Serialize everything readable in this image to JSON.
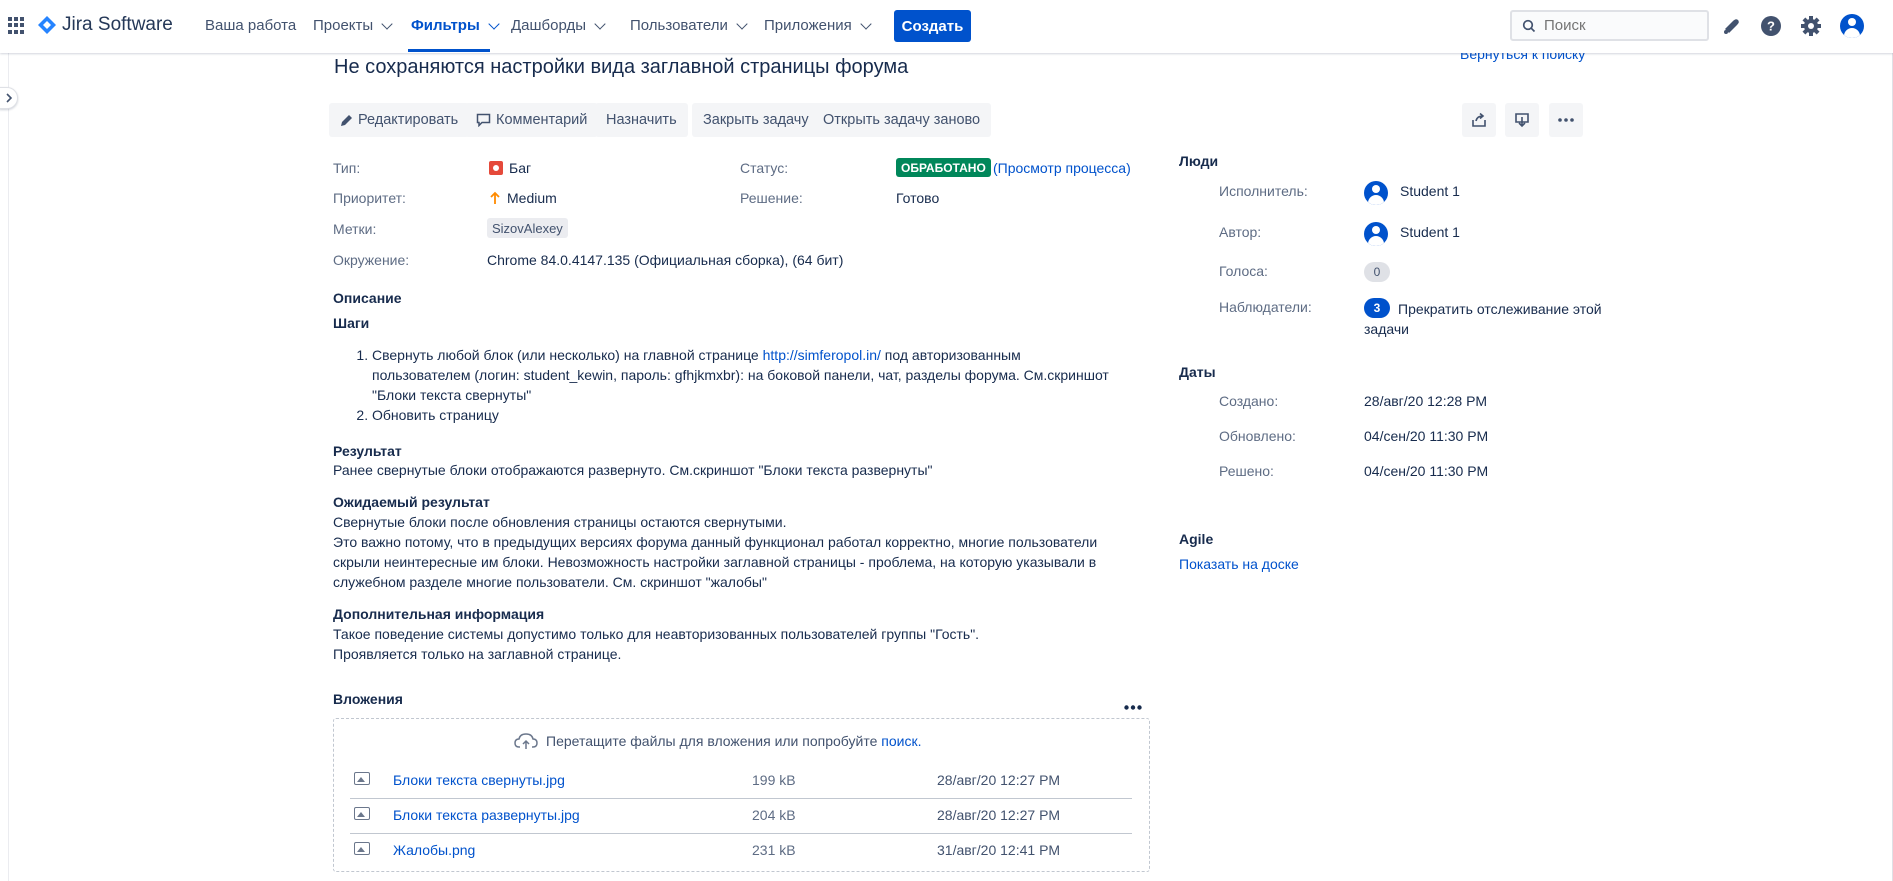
{
  "nav": {
    "product": "Jira Software",
    "items": [
      {
        "label": "Ваша работа",
        "dropdown": false
      },
      {
        "label": "Проекты",
        "dropdown": true
      },
      {
        "label": "Фильтры",
        "dropdown": true,
        "active": true
      },
      {
        "label": "Дашборды",
        "dropdown": true
      },
      {
        "label": "Пользователи",
        "dropdown": true
      },
      {
        "label": "Приложения",
        "dropdown": true
      }
    ],
    "create_label": "Создать",
    "search_placeholder": "Поиск",
    "brand_color": "#0052CC"
  },
  "back_link": "Вернуться к поиску",
  "issue": {
    "title": "Не сохраняются настройки вида заглавной страницы форума"
  },
  "actions": {
    "edit": "Редактировать",
    "comment": "Комментарий",
    "assign": "Назначить",
    "close": "Закрыть задачу",
    "reopen": "Открыть задачу заново"
  },
  "details": {
    "type_label": "Тип:",
    "type_value": "Баг",
    "priority_label": "Приоритет:",
    "priority_value": "Medium",
    "labels_label": "Метки:",
    "labels_value": "SizovAlexey",
    "env_label": "Окружение:",
    "env_value": "Chrome 84.0.4147.135 (Официальная сборка), (64 бит)",
    "status_label": "Статус:",
    "status_value": "ОБРАБОТАНО",
    "status_link": "(Просмотр процесса)",
    "resolution_label": "Решение:",
    "resolution_value": "Готово"
  },
  "description": {
    "heading": "Описание",
    "steps_heading": "Шаги",
    "step1_before": "Свернуть любой блок (или несколько) на главной странице ",
    "step1_link": "http://simferopol.in/",
    "step1_after": " под авторизованным пользователем (логин: student_kewin, пароль: gfhjkmxbr): на боковой панели, чат, разделы форума. См.скриншот \"Блоки текста свернуты\"",
    "step2": "Обновить страницу",
    "result_heading": "Результат",
    "result_text": "Ранее свернутые блоки отображаются развернуто. См.скриншот \"Блоки текста развернуты\"",
    "expected_heading": "Ожидаемый результат",
    "expected_line1": "Свернутые блоки после обновления страницы остаются свернутыми.",
    "expected_line2": "Это важно потому, что в предыдущих версиях форума данный функционал работал корректно, многие пользователи скрыли неинтересные им блоки. Невозможность настройки заглавной страницы - проблема, на которую указывали в служебном разделе многие пользователи. См. скриншот \"жалобы\"",
    "extra_heading": "Дополнительная информация",
    "extra_line1": "Такое поведение системы допустимо только для неавторизованных пользователей группы \"Гость\".",
    "extra_line2": "Проявляется только на заглавной странице."
  },
  "attachments": {
    "heading": "Вложения",
    "drop_text": "Перетащите файлы для вложения или попробуйте ",
    "drop_link": "поиск.",
    "files": [
      {
        "name": "Блоки текста свернуты.jpg",
        "size": "199 kB",
        "date": "28/авг/20 12:27 PM"
      },
      {
        "name": "Блоки текста развернуты.jpg",
        "size": "204 kB",
        "date": "28/авг/20 12:27 PM"
      },
      {
        "name": "Жалобы.png",
        "size": "231 kB",
        "date": "31/авг/20 12:41 PM"
      }
    ]
  },
  "people": {
    "heading": "Люди",
    "assignee_label": "Исполнитель:",
    "assignee": "Student 1",
    "reporter_label": "Автор:",
    "reporter": "Student 1",
    "votes_label": "Голоса:",
    "votes": "0",
    "watchers_label": "Наблюдатели:",
    "watchers": "3",
    "watch_link": "Прекратить отслеживание этой задачи"
  },
  "dates": {
    "heading": "Даты",
    "created_label": "Создано:",
    "created": "28/авг/20 12:28 PM",
    "updated_label": "Обновлено:",
    "updated": "04/сен/20 11:30 PM",
    "resolved_label": "Решено:",
    "resolved": "04/сен/20 11:30 PM"
  },
  "agile": {
    "heading": "Agile",
    "board_link": "Показать на доске"
  }
}
